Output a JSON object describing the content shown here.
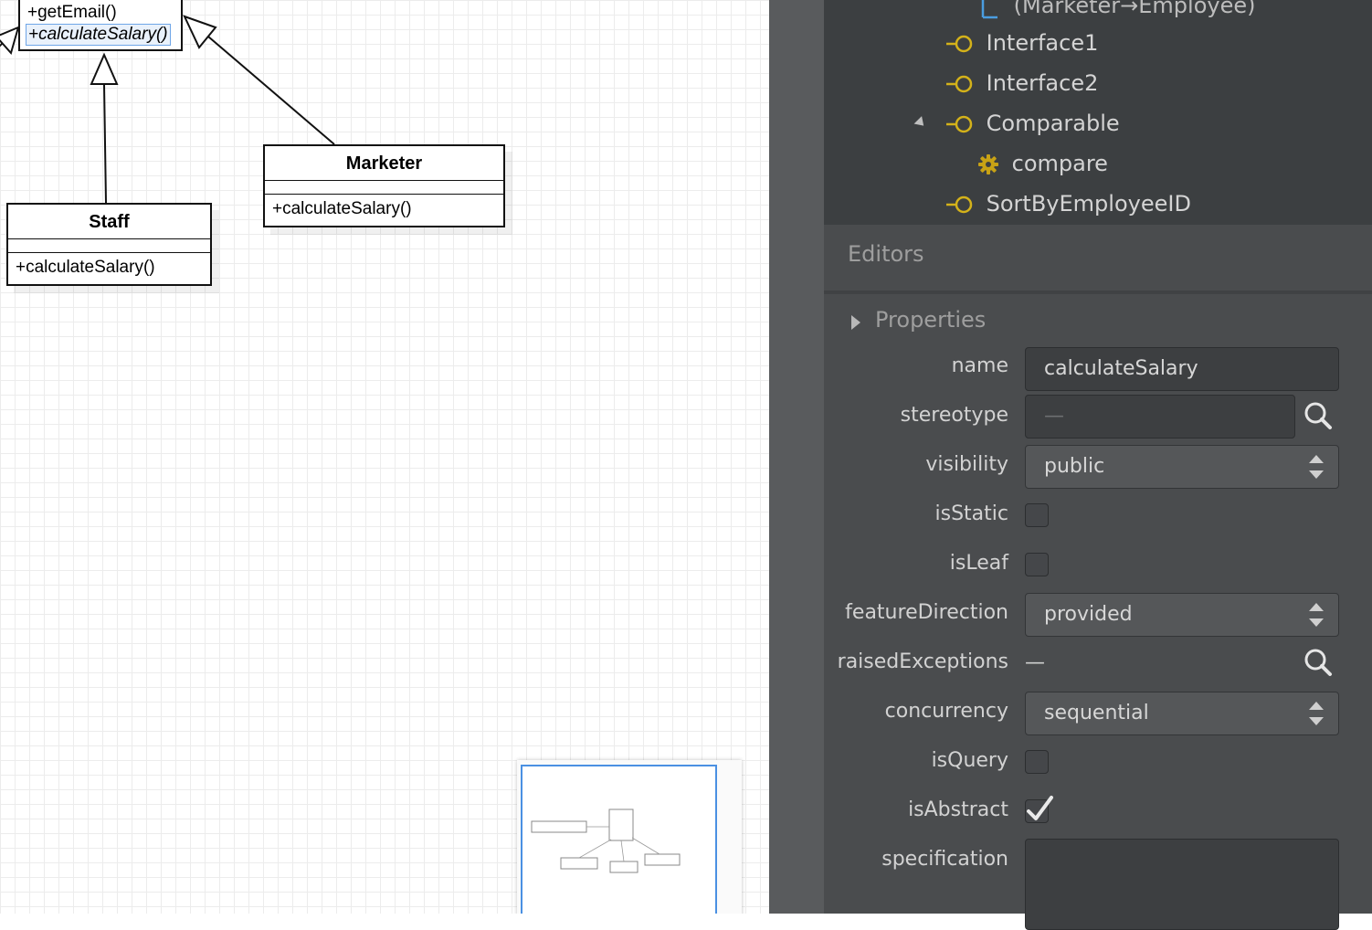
{
  "canvas": {
    "employee_ops": [
      "+getEmail()",
      "+calculateSalary()"
    ],
    "classes": [
      {
        "name": "Staff",
        "operation": "+calculateSalary()"
      },
      {
        "name": "Marketer",
        "operation": "+calculateSalary()"
      }
    ]
  },
  "model_tree": {
    "items": [
      {
        "label": "(Marketer→Employee)",
        "icon": "generalization-icon"
      },
      {
        "label": "Interface1",
        "icon": "interface-icon"
      },
      {
        "label": "Interface2",
        "icon": "interface-icon"
      },
      {
        "label": "Comparable",
        "icon": "interface-icon",
        "expanded": true
      },
      {
        "label": "compare",
        "icon": "operation-gear-icon"
      },
      {
        "label": "SortByEmployeeID",
        "icon": "interface-icon"
      }
    ]
  },
  "editors": {
    "title": "Editors",
    "section": "Properties",
    "props": {
      "name": {
        "label": "name",
        "value": "calculateSalary"
      },
      "stereotype": {
        "label": "stereotype",
        "value": "—"
      },
      "visibility": {
        "label": "visibility",
        "value": "public"
      },
      "isStatic": {
        "label": "isStatic",
        "checked": false
      },
      "isLeaf": {
        "label": "isLeaf",
        "checked": false
      },
      "featureDirection": {
        "label": "featureDirection",
        "value": "provided"
      },
      "raisedExceptions": {
        "label": "raisedExceptions",
        "value": "—"
      },
      "concurrency": {
        "label": "concurrency",
        "value": "sequential"
      },
      "isQuery": {
        "label": "isQuery",
        "checked": false
      },
      "isAbstract": {
        "label": "isAbstract",
        "checked": true
      },
      "specification": {
        "label": "specification",
        "value": ""
      }
    }
  },
  "colors": {
    "tree_bg": "#3c3f41",
    "editor_bg": "#4a4c4e",
    "interface_icon": "#d4b21a",
    "selection_border": "#4a90e2"
  }
}
